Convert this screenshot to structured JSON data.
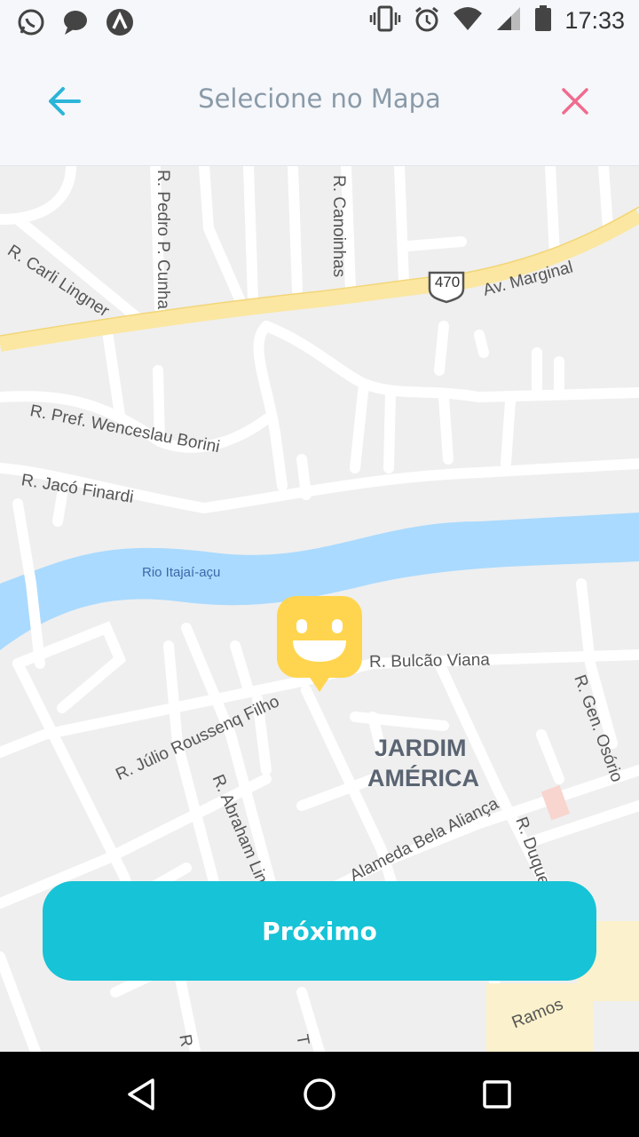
{
  "status_bar": {
    "time": "17:33",
    "left_icons": [
      "whatsapp-icon",
      "chat-bubble-icon",
      "app-a-icon"
    ],
    "right_icons": [
      "vibrate-icon",
      "alarm-icon",
      "wifi-icon",
      "signal-icon",
      "battery-icon"
    ]
  },
  "header": {
    "title": "Selecione no Mapa",
    "back_icon": "arrow-left-icon",
    "close_icon": "close-icon",
    "accent_color": "#2bb5d8",
    "close_color": "#f06b8f"
  },
  "map": {
    "labels": {
      "carli": "R. Carli Lingner",
      "pedro": "R. Pedro P. Cunha",
      "canoinhas": "R. Canoinhas",
      "shield": "470",
      "marginal": "Av. Marginal",
      "wenceslau": "R. Pref. Wenceslau Borini",
      "jaco": "R. Jacó Finardi",
      "rio": "Rio Itajaí-açu",
      "bulcao": "R. Bulcão Viana",
      "julio": "R. Júlio Roussenq Filho",
      "abraham": "R. Abraham Lin",
      "osorio": "R. Gen. Osório",
      "jardim1": "JARDIM",
      "jardim2": "AMÉRICA",
      "alameda": "Alameda Bela Aliança",
      "duque": "R. Duque",
      "ramos": "Ramos",
      "r_frag": "R",
      "t_frag": "T"
    },
    "colors": {
      "land": "#efefef",
      "road": "#ffffff",
      "highway": "#fbe7a1",
      "water": "#aadaff"
    }
  },
  "marker": {
    "icon": "smiley-pin-icon",
    "color": "#ffd54f"
  },
  "next_button": {
    "label": "Próximo",
    "color": "#17c3d6"
  },
  "nav_bar": {
    "icons": [
      "back-triangle-icon",
      "home-circle-icon",
      "recents-square-icon"
    ]
  }
}
